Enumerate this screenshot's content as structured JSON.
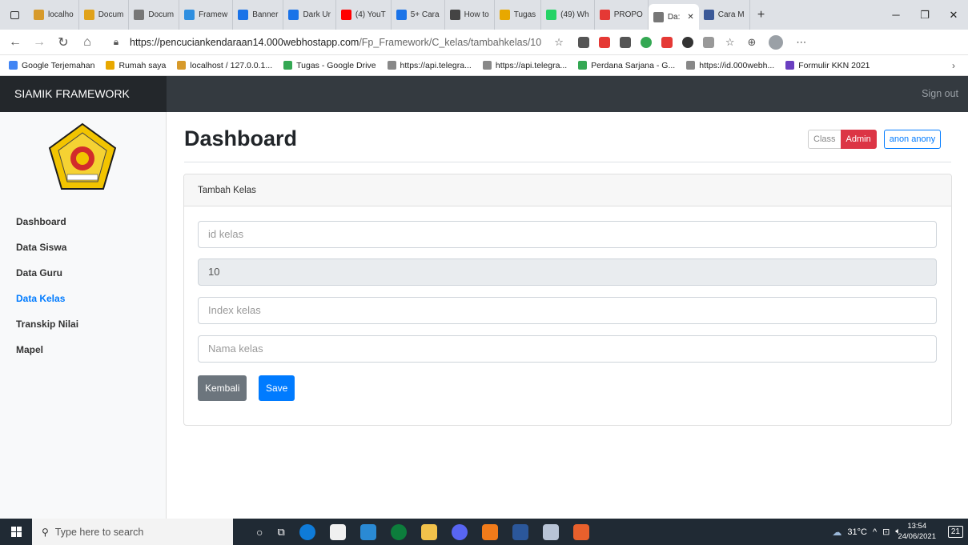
{
  "browser": {
    "tabs": [
      {
        "label": "localho",
        "color": "#d79a2b"
      },
      {
        "label": "Docum",
        "color": "#e0a21a"
      },
      {
        "label": "Docum",
        "color": "#777777"
      },
      {
        "label": "Framew",
        "color": "#2f8fe0"
      },
      {
        "label": "Banner",
        "color": "#1a73e8"
      },
      {
        "label": "Dark Ur",
        "color": "#1a73e8"
      },
      {
        "label": "(4) YouT",
        "color": "#ff0000"
      },
      {
        "label": "5+ Cara",
        "color": "#1a73e8"
      },
      {
        "label": "How to",
        "color": "#444444"
      },
      {
        "label": "Tugas",
        "color": "#e8a800"
      },
      {
        "label": "(49) Wh",
        "color": "#25d366"
      },
      {
        "label": "PROPO",
        "color": "#e53935"
      },
      {
        "label": "Da:",
        "color": "#777777"
      },
      {
        "label": "Cara M",
        "color": "#3b5998"
      }
    ],
    "active_tab_index": 12,
    "url_host": "https://pencuciankendaraan14.000webhostapp.com",
    "url_path": "/Fp_Framework/C_kelas/tambahkelas/10",
    "bookmarks": [
      {
        "label": "Google Terjemahan",
        "color": "#4285f4"
      },
      {
        "label": "Rumah saya",
        "color": "#e8a800"
      },
      {
        "label": "localhost / 127.0.0.1...",
        "color": "#d79a2b"
      },
      {
        "label": "Tugas - Google Drive",
        "color": "#34a853"
      },
      {
        "label": "https://api.telegra...",
        "color": "#888888"
      },
      {
        "label": "https://api.telegra...",
        "color": "#888888"
      },
      {
        "label": "Perdana Sarjana - G...",
        "color": "#34a853"
      },
      {
        "label": "https://id.000webh...",
        "color": "#888888"
      },
      {
        "label": "Formulir KKN 2021",
        "color": "#6a3fc1"
      }
    ]
  },
  "app": {
    "brand": "SIAMIK FRAMEWORK",
    "signout": "Sign out",
    "sidebar": [
      "Dashboard",
      "Data Siswa",
      "Data Guru",
      "Data Kelas",
      "Transkip Nilai",
      "Mapel"
    ],
    "active_index": 3,
    "page_title": "Dashboard",
    "btn_class": "Class",
    "btn_admin": "Admin",
    "btn_user": "anon anony",
    "card_title": "Tambah Kelas",
    "field_id_placeholder": "id kelas",
    "field_disabled_value": "10",
    "field_index_placeholder": "Index kelas",
    "field_nama_placeholder": "Nama kelas",
    "btn_back": "Kembali",
    "btn_save": "Save",
    "colors": {
      "primary": "#007bff",
      "secondary": "#6c757d",
      "danger": "#dc3545",
      "navbar": "#343a40"
    }
  },
  "taskbar": {
    "search_placeholder": "Type here to search",
    "weather": "31°C",
    "time": "13:54",
    "date": "24/06/2021",
    "notif_count": "21"
  }
}
